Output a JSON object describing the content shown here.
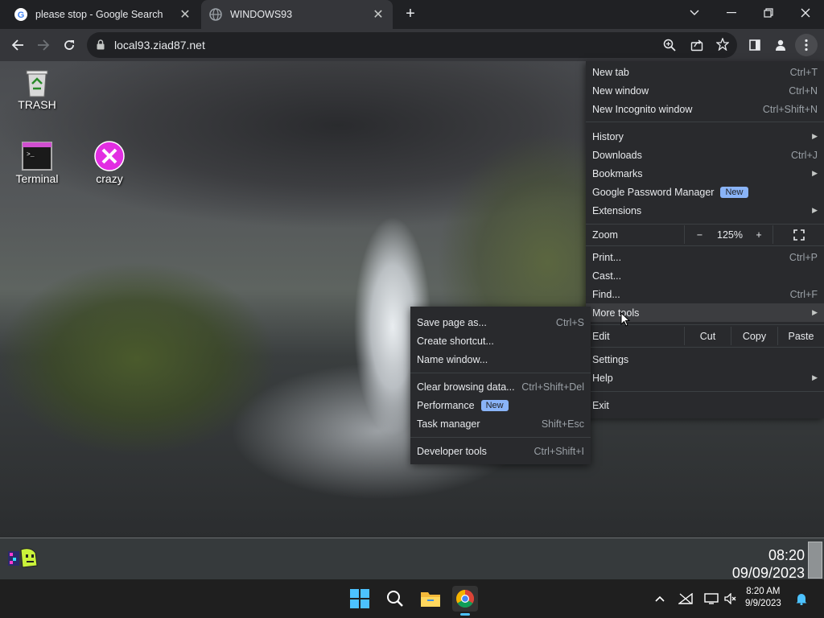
{
  "browser": {
    "tabs": [
      {
        "title": "please stop - Google Search",
        "favicon": "google-g-icon",
        "active": false
      },
      {
        "title": "WINDOWS93",
        "favicon": "globe-icon",
        "active": true
      }
    ],
    "url": "local93.ziad87.net"
  },
  "desktop": {
    "icons": [
      {
        "label": "TRASH",
        "icon": "recycle-bin-icon"
      },
      {
        "label": "Terminal",
        "icon": "terminal-icon"
      },
      {
        "label": "crazy",
        "icon": "crazy-x-icon"
      }
    ]
  },
  "menu": {
    "items": [
      {
        "label": "New tab",
        "shortcut": "Ctrl+T"
      },
      {
        "label": "New window",
        "shortcut": "Ctrl+N"
      },
      {
        "label": "New Incognito window",
        "shortcut": "Ctrl+Shift+N"
      },
      {
        "label": "History",
        "shortcut": ""
      },
      {
        "label": "Downloads",
        "shortcut": "Ctrl+J"
      },
      {
        "label": "Bookmarks",
        "shortcut": ""
      },
      {
        "label": "Google Password Manager",
        "badge": "New"
      },
      {
        "label": "Extensions",
        "shortcut": ""
      },
      {
        "label": "Print...",
        "shortcut": "Ctrl+P"
      },
      {
        "label": "Cast...",
        "shortcut": ""
      },
      {
        "label": "Find...",
        "shortcut": "Ctrl+F"
      },
      {
        "label": "More tools",
        "shortcut": ""
      },
      {
        "label": "Settings",
        "shortcut": ""
      },
      {
        "label": "Help",
        "shortcut": ""
      },
      {
        "label": "Exit",
        "shortcut": ""
      }
    ],
    "zoom": {
      "label": "Zoom",
      "minus": "−",
      "value": "125%",
      "plus": "+"
    },
    "edit": {
      "label": "Edit",
      "cut": "Cut",
      "copy": "Copy",
      "paste": "Paste"
    }
  },
  "submenu": {
    "items": [
      {
        "label": "Save page as...",
        "shortcut": "Ctrl+S"
      },
      {
        "label": "Create shortcut...",
        "shortcut": ""
      },
      {
        "label": "Name window...",
        "shortcut": ""
      },
      {
        "label": "Clear browsing data...",
        "shortcut": "Ctrl+Shift+Del"
      },
      {
        "label": "Performance",
        "badge": "New"
      },
      {
        "label": "Task manager",
        "shortcut": "Shift+Esc"
      },
      {
        "label": "Developer tools",
        "shortcut": "Ctrl+Shift+I"
      }
    ]
  },
  "win93": {
    "time": "08:20",
    "date": "09/09/2023"
  },
  "taskbar": {
    "time": "8:20 AM",
    "date": "9/9/2023"
  }
}
